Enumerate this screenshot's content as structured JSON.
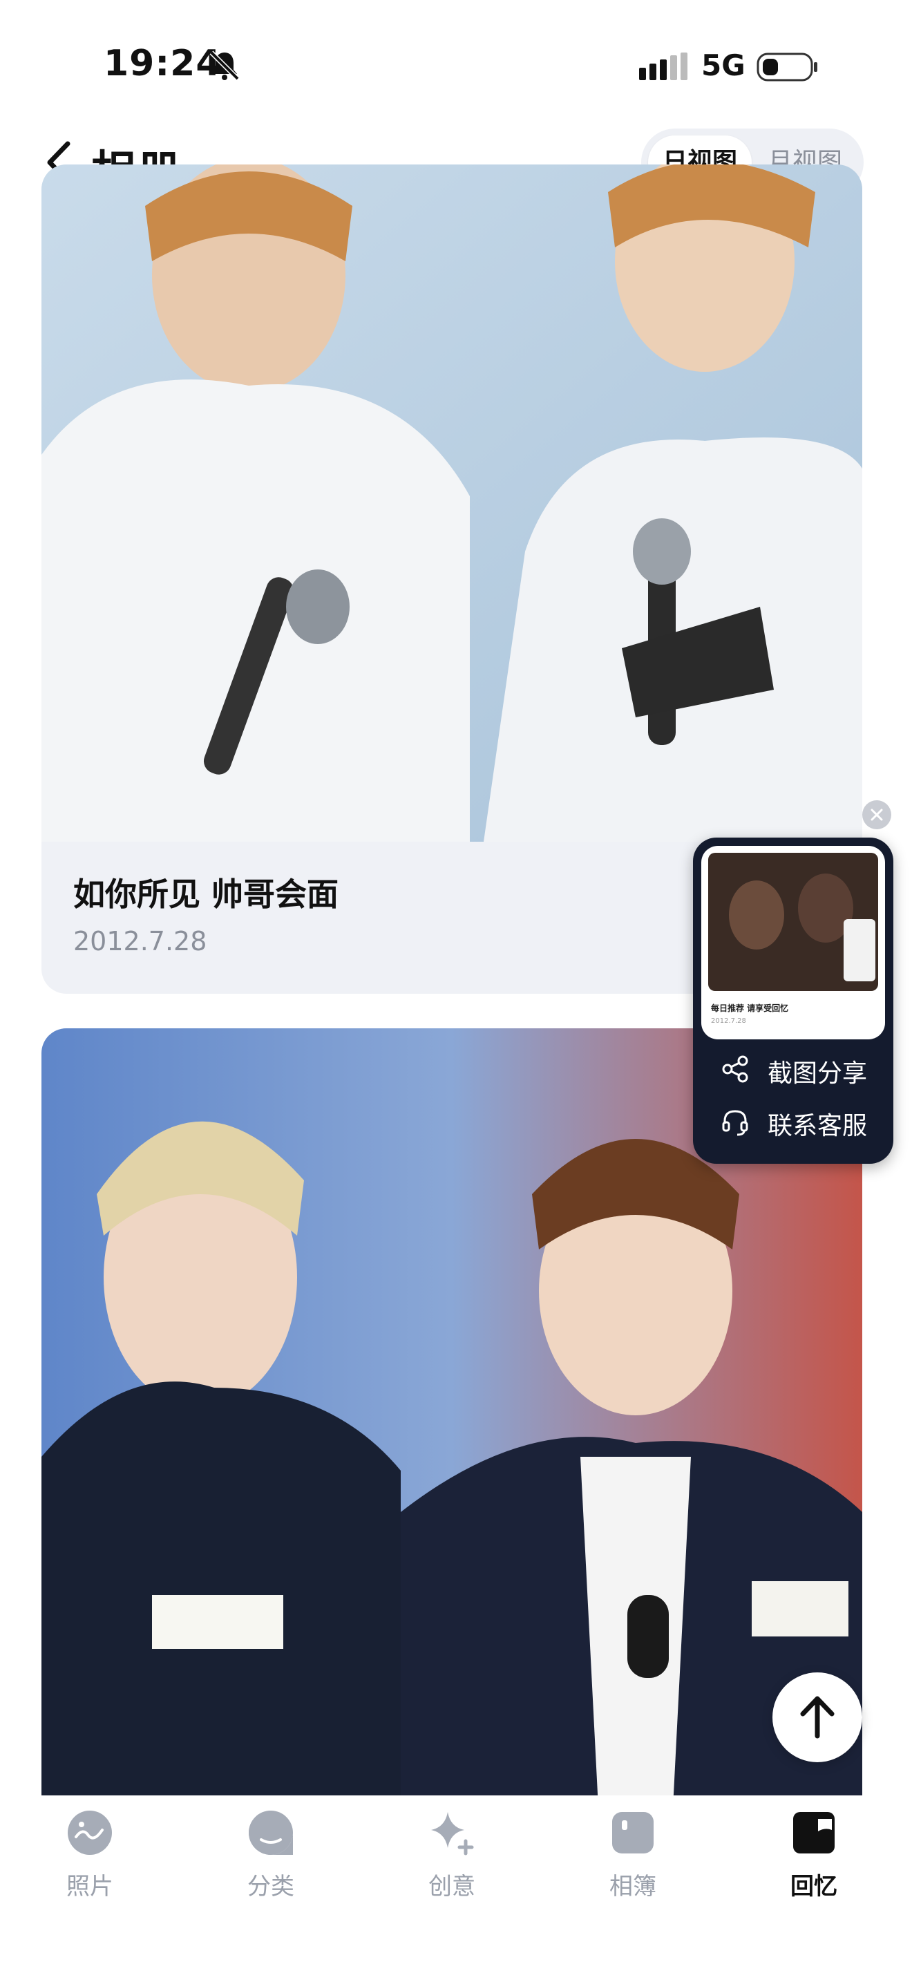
{
  "status_bar": {
    "time": "19:24",
    "network": "5G"
  },
  "header": {
    "title": "相册",
    "view_day": "日视图",
    "view_month": "月视图"
  },
  "cards": [
    {
      "title": "如你所见 帅哥会面",
      "date": "2012.7.28"
    },
    {
      "title": "",
      "date": ""
    }
  ],
  "float_panel": {
    "thumb_title": "每日推荐 请享受回忆",
    "thumb_date": "2012.7.28",
    "actions": [
      {
        "label": "截图分享",
        "icon": "share-icon"
      },
      {
        "label": "联系客服",
        "icon": "headset-icon"
      }
    ]
  },
  "tabs": [
    {
      "label": "照片",
      "icon": "photo-icon"
    },
    {
      "label": "分类",
      "icon": "category-icon"
    },
    {
      "label": "创意",
      "icon": "sparkle-icon"
    },
    {
      "label": "相簿",
      "icon": "album-icon"
    },
    {
      "label": "回忆",
      "icon": "memory-icon",
      "active": true
    }
  ],
  "colors": {
    "accent": "#111111",
    "inactive": "#9aa0ab",
    "panel": "#141b2e"
  }
}
